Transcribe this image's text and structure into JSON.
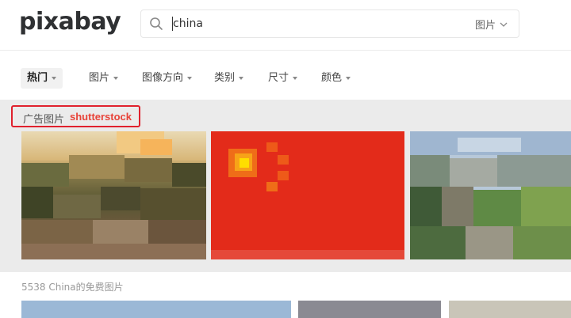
{
  "header": {
    "logo": "pixabay",
    "search": {
      "value": "china",
      "type_label": "图片"
    }
  },
  "filters": [
    {
      "label": "热门",
      "active": true
    },
    {
      "label": "图片"
    },
    {
      "label": "图像方向"
    },
    {
      "label": "类别"
    },
    {
      "label": "尺寸"
    },
    {
      "label": "颜色"
    }
  ],
  "ads": {
    "label": "广告图片",
    "sponsor": "shutterstock",
    "images": [
      {
        "name": "great-wall-sunset"
      },
      {
        "name": "china-flag"
      },
      {
        "name": "great-wall-green"
      }
    ]
  },
  "results": {
    "count_text": "5538 China的免费图片"
  },
  "colors": {
    "brand_red": "#e0212d",
    "flag_red": "#e32b1a",
    "flag_yellow": "#ffde00"
  }
}
